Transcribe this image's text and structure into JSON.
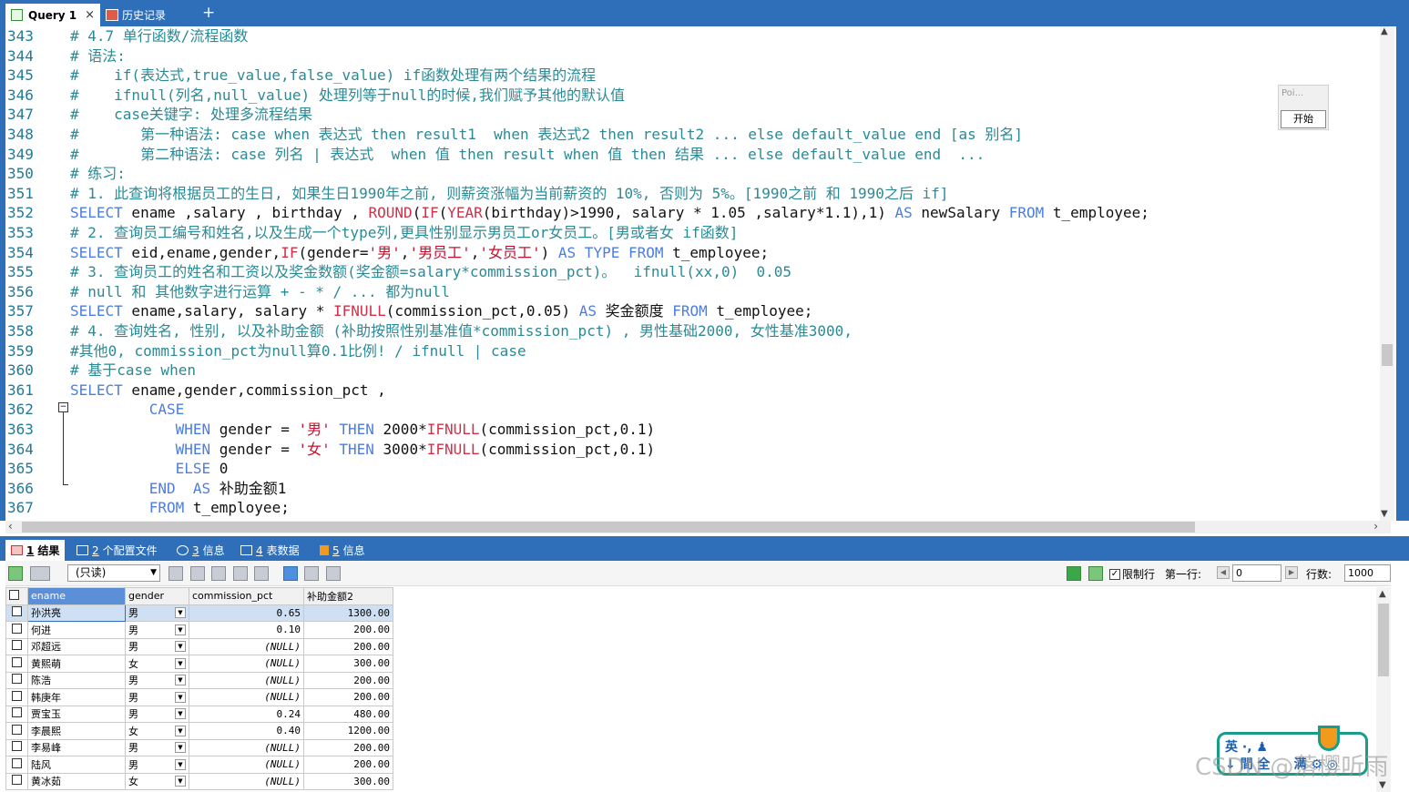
{
  "tabs": {
    "query_tab": "Query 1",
    "query_close": "×",
    "history_tab": "历史记录",
    "add_tab": "+"
  },
  "editor": {
    "lines": [
      {
        "n": "343",
        "parts": [
          {
            "c": "cm",
            "t": "# 4.7 单行函数/流程函数"
          }
        ]
      },
      {
        "n": "344",
        "parts": [
          {
            "c": "cm",
            "t": "# 语法:"
          }
        ]
      },
      {
        "n": "345",
        "parts": [
          {
            "c": "cm",
            "t": "#    if(表达式,true_value,false_value) if函数处理有两个结果的流程"
          }
        ]
      },
      {
        "n": "346",
        "parts": [
          {
            "c": "cm",
            "t": "#    ifnull(列名,null_value) 处理列等于null的时候,我们赋予其他的默认值"
          }
        ]
      },
      {
        "n": "347",
        "parts": [
          {
            "c": "cm",
            "t": "#    case关键字: 处理多流程结果"
          }
        ]
      },
      {
        "n": "348",
        "parts": [
          {
            "c": "cm",
            "t": "#       第一种语法: case when 表达式 then result1  when 表达式2 then result2 ... else default_value end [as 别名]"
          }
        ]
      },
      {
        "n": "349",
        "parts": [
          {
            "c": "cm",
            "t": "#       第二种语法: case 列名 | 表达式  when 值 then result when 值 then 结果 ... else default_value end  ..."
          }
        ]
      },
      {
        "n": "350",
        "parts": [
          {
            "c": "cm",
            "t": "# 练习:"
          }
        ]
      },
      {
        "n": "351",
        "parts": [
          {
            "c": "cm",
            "t": "# 1. 此查询将根据员工的生日, 如果生日1990年之前, 则薪资涨幅为当前薪资的 10%, 否则为 5%。[1990之前 和 1990之后 if]"
          }
        ]
      },
      {
        "n": "352",
        "parts": [
          {
            "c": "kw",
            "t": "SELECT"
          },
          {
            "c": "tx",
            "t": " ename ,salary , birthday , "
          },
          {
            "c": "fn",
            "t": "ROUND"
          },
          {
            "c": "tx",
            "t": "("
          },
          {
            "c": "fn",
            "t": "IF"
          },
          {
            "c": "tx",
            "t": "("
          },
          {
            "c": "fn",
            "t": "YEAR"
          },
          {
            "c": "tx",
            "t": "(birthday)>1990, salary * 1.05 ,salary*1.1),1) "
          },
          {
            "c": "kw",
            "t": "AS"
          },
          {
            "c": "tx",
            "t": " newSalary "
          },
          {
            "c": "kw",
            "t": "FROM"
          },
          {
            "c": "tx",
            "t": " t_employee;"
          }
        ]
      },
      {
        "n": "353",
        "parts": [
          {
            "c": "cm",
            "t": "# 2. 查询员工编号和姓名,以及生成一个type列,更具性别显示男员工or女员工。[男或者女 if函数]"
          }
        ]
      },
      {
        "n": "354",
        "parts": [
          {
            "c": "kw",
            "t": "SELECT"
          },
          {
            "c": "tx",
            "t": " eid,ename,gender,"
          },
          {
            "c": "fn",
            "t": "IF"
          },
          {
            "c": "tx",
            "t": "(gender="
          },
          {
            "c": "str",
            "t": "'男'"
          },
          {
            "c": "tx",
            "t": ","
          },
          {
            "c": "str",
            "t": "'男员工'"
          },
          {
            "c": "tx",
            "t": ","
          },
          {
            "c": "str",
            "t": "'女员工'"
          },
          {
            "c": "tx",
            "t": ") "
          },
          {
            "c": "kw",
            "t": "AS TYPE FROM"
          },
          {
            "c": "tx",
            "t": " t_employee;"
          }
        ]
      },
      {
        "n": "355",
        "parts": [
          {
            "c": "cm",
            "t": "# 3. 查询员工的姓名和工资以及奖金数额(奖金额=salary*commission_pct)。  ifnull(xx,0)  0.05"
          }
        ]
      },
      {
        "n": "356",
        "parts": [
          {
            "c": "cm",
            "t": "# null 和 其他数字进行运算 + - * / ... 都为null"
          }
        ]
      },
      {
        "n": "357",
        "parts": [
          {
            "c": "kw",
            "t": "SELECT"
          },
          {
            "c": "tx",
            "t": " ename,salary, salary * "
          },
          {
            "c": "fn",
            "t": "IFNULL"
          },
          {
            "c": "tx",
            "t": "(commission_pct,0.05) "
          },
          {
            "c": "kw",
            "t": "AS"
          },
          {
            "c": "tx",
            "t": " 奖金额度 "
          },
          {
            "c": "kw",
            "t": "FROM"
          },
          {
            "c": "tx",
            "t": " t_employee;"
          }
        ]
      },
      {
        "n": "358",
        "parts": [
          {
            "c": "cm",
            "t": "# 4. 查询姓名, 性别, 以及补助金额 (补助按照性别基准值*commission_pct) , 男性基础2000, 女性基准3000,"
          }
        ]
      },
      {
        "n": "359",
        "parts": [
          {
            "c": "cm",
            "t": "#其他0, commission_pct为null算0.1比例! / ifnull | case"
          }
        ]
      },
      {
        "n": "360",
        "parts": [
          {
            "c": "cm",
            "t": "# 基于case when"
          }
        ]
      },
      {
        "n": "361",
        "parts": [
          {
            "c": "kw",
            "t": "SELECT"
          },
          {
            "c": "tx",
            "t": " ename,gender,commission_pct ,"
          }
        ]
      },
      {
        "n": "362",
        "parts": [
          {
            "c": "kw",
            "t": "         CASE"
          }
        ]
      },
      {
        "n": "363",
        "parts": [
          {
            "c": "kw",
            "t": "            WHEN"
          },
          {
            "c": "tx",
            "t": " gender = "
          },
          {
            "c": "str",
            "t": "'男'"
          },
          {
            "c": "tx",
            "t": " "
          },
          {
            "c": "kw",
            "t": "THEN"
          },
          {
            "c": "tx",
            "t": " 2000*"
          },
          {
            "c": "fn",
            "t": "IFNULL"
          },
          {
            "c": "tx",
            "t": "(commission_pct,0.1)"
          }
        ]
      },
      {
        "n": "364",
        "parts": [
          {
            "c": "kw",
            "t": "            WHEN"
          },
          {
            "c": "tx",
            "t": " gender = "
          },
          {
            "c": "str",
            "t": "'女'"
          },
          {
            "c": "tx",
            "t": " "
          },
          {
            "c": "kw",
            "t": "THEN"
          },
          {
            "c": "tx",
            "t": " 3000*"
          },
          {
            "c": "fn",
            "t": "IFNULL"
          },
          {
            "c": "tx",
            "t": "(commission_pct,0.1)"
          }
        ]
      },
      {
        "n": "365",
        "parts": [
          {
            "c": "kw",
            "t": "            ELSE"
          },
          {
            "c": "tx",
            "t": " 0"
          }
        ]
      },
      {
        "n": "366",
        "parts": [
          {
            "c": "kw",
            "t": "         END  AS"
          },
          {
            "c": "tx",
            "t": " 补助金额1"
          }
        ]
      },
      {
        "n": "367",
        "parts": [
          {
            "c": "kw",
            "t": "         FROM"
          },
          {
            "c": "tx",
            "t": " t_employee;"
          }
        ]
      }
    ]
  },
  "profiler": {
    "title": "Poi...",
    "start_label": "开始"
  },
  "result_tabs": [
    {
      "num": "1",
      "label": "结果"
    },
    {
      "num": "2",
      "label": "个配置文件"
    },
    {
      "num": "3",
      "label": "信息"
    },
    {
      "num": "4",
      "label": "表数据"
    },
    {
      "num": "5",
      "label": "信息"
    }
  ],
  "toolbar": {
    "readonly_option": "(只读)",
    "limit_label": "限制行",
    "first_row_label": "第一行:",
    "first_row_value": "0",
    "row_count_label": "行数:",
    "row_count_value": "1000"
  },
  "grid": {
    "columns": [
      "ename",
      "gender",
      "commission_pct",
      "补助金额2"
    ],
    "rows": [
      [
        "孙洪亮",
        "男",
        "0.65",
        "1300.00"
      ],
      [
        "何进",
        "男",
        "0.10",
        "200.00"
      ],
      [
        "邓超远",
        "男",
        "(NULL)",
        "200.00"
      ],
      [
        "黄熙萌",
        "女",
        "(NULL)",
        "300.00"
      ],
      [
        "陈浩",
        "男",
        "(NULL)",
        "200.00"
      ],
      [
        "韩庚年",
        "男",
        "(NULL)",
        "200.00"
      ],
      [
        "贾宝玉",
        "男",
        "0.24",
        "480.00"
      ],
      [
        "李晨熙",
        "女",
        "0.40",
        "1200.00"
      ],
      [
        "李易峰",
        "男",
        "(NULL)",
        "200.00"
      ],
      [
        "陆风",
        "男",
        "(NULL)",
        "200.00"
      ],
      [
        "黄冰茹",
        "女",
        "(NULL)",
        "300.00"
      ]
    ]
  },
  "ime": {
    "line1": "英 ·, ♟",
    "line2": "↓ 間 全",
    "line3": "满 ⚙ ◎"
  },
  "watermark": "CSDN @落樱听雨"
}
